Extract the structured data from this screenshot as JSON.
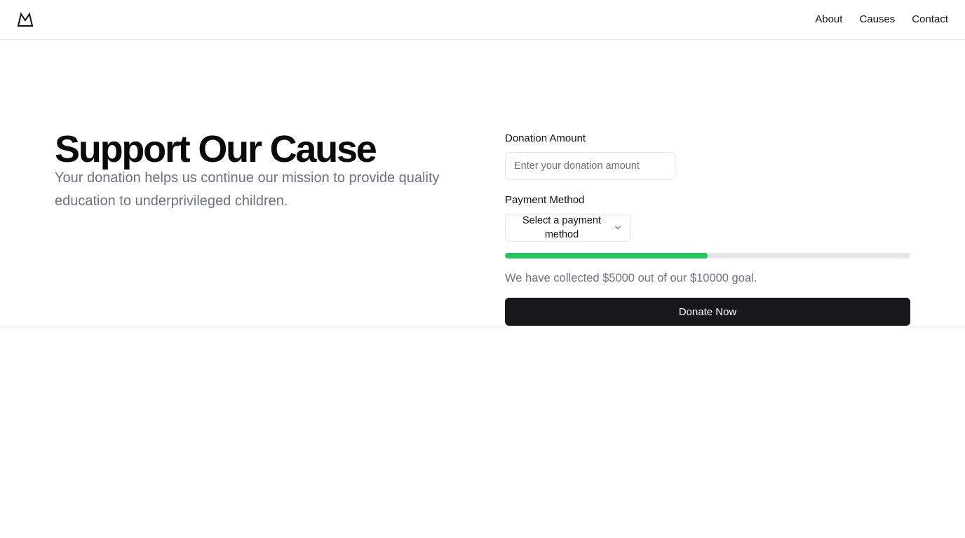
{
  "header": {
    "logo_icon": "mountain-icon",
    "nav": [
      {
        "label": "About"
      },
      {
        "label": "Causes"
      },
      {
        "label": "Contact"
      }
    ]
  },
  "hero": {
    "title": "Support Our Cause",
    "subtitle": "Your donation helps us continue our mission to provide quality education to underprivileged children."
  },
  "form": {
    "amount_label": "Donation Amount",
    "amount_value": "",
    "amount_placeholder": "Enter your donation amount",
    "payment_label": "Payment Method",
    "payment_selected": "Select a payment method",
    "payment_icon": "chevron-down-icon",
    "progress": {
      "collected": 5000,
      "goal": 10000,
      "fraction": 0.5,
      "fill_color": "#22c55e",
      "track_color": "#e5e7eb"
    },
    "collected_text": "We have collected $5000 out of our $10000 goal.",
    "donate_label": "Donate Now",
    "donate_color": "#18181b"
  }
}
